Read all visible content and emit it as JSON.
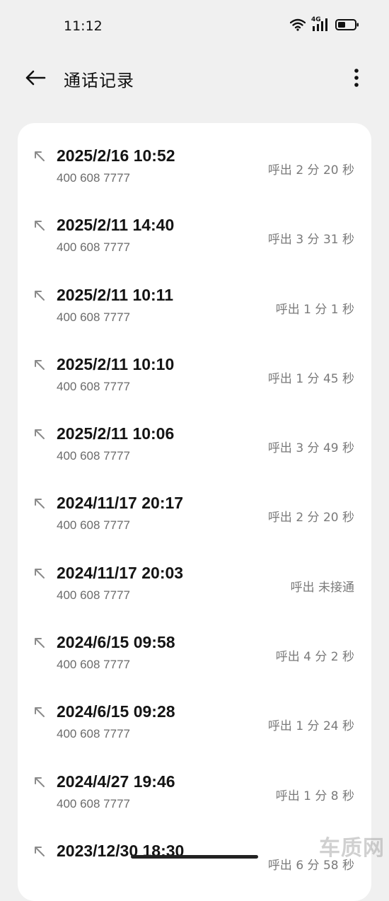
{
  "status_bar": {
    "time": "11:12",
    "network_label": "4G"
  },
  "header": {
    "title": "通话记录",
    "back_icon": "arrow-left-icon",
    "more_icon": "more-vertical-icon"
  },
  "calls": [
    {
      "date": "2025/2/16 10:52",
      "number": "400 608 7777",
      "info": "呼出  2 分 20 秒"
    },
    {
      "date": "2025/2/11 14:40",
      "number": "400 608 7777",
      "info": "呼出  3 分 31 秒"
    },
    {
      "date": "2025/2/11 10:11",
      "number": "400 608 7777",
      "info": "呼出  1 分 1 秒"
    },
    {
      "date": "2025/2/11 10:10",
      "number": "400 608 7777",
      "info": "呼出  1 分 45 秒"
    },
    {
      "date": "2025/2/11 10:06",
      "number": "400 608 7777",
      "info": "呼出  3 分 49 秒"
    },
    {
      "date": "2024/11/17 20:17",
      "number": "400 608 7777",
      "info": "呼出  2 分 20 秒"
    },
    {
      "date": "2024/11/17 20:03",
      "number": "400 608 7777",
      "info": "呼出 未接通"
    },
    {
      "date": "2024/6/15 09:58",
      "number": "400 608 7777",
      "info": "呼出  4 分 2 秒"
    },
    {
      "date": "2024/6/15 09:28",
      "number": "400 608 7777",
      "info": "呼出  1 分 24 秒"
    },
    {
      "date": "2024/4/27 19:46",
      "number": "400 608 7777",
      "info": "呼出  1 分 8 秒"
    },
    {
      "date": "2023/12/30 18:30",
      "number": "",
      "info": "呼出  6 分 58 秒"
    }
  ],
  "watermark": "车质网",
  "colors": {
    "background": "#f0f0f0",
    "card": "#ffffff",
    "text_primary": "#141414",
    "text_secondary": "#6b6b6b",
    "outgoing_icon": "#8a8a8a"
  }
}
